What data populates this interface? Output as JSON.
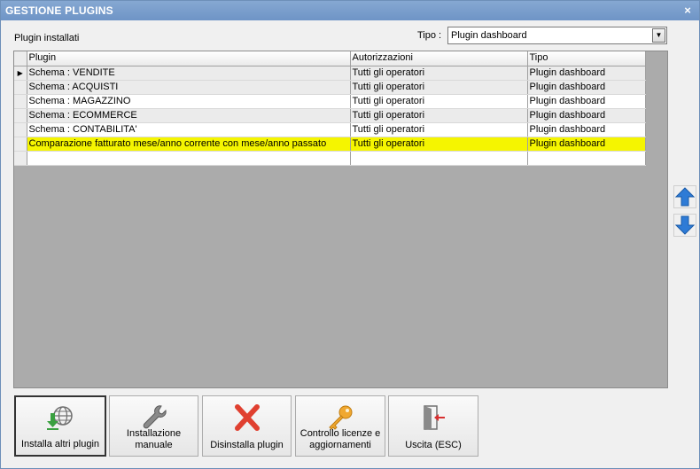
{
  "window": {
    "title": "GESTIONE PLUGINS",
    "close_glyph": "×"
  },
  "labels": {
    "installed": "Plugin installati",
    "tipo": "Tipo :"
  },
  "tipo_select": {
    "value": "Plugin dashboard",
    "arrow_glyph": "▼"
  },
  "grid": {
    "columns": [
      "Plugin",
      "Autorizzazioni",
      "Tipo"
    ],
    "current_row_glyph": "▶",
    "rows": [
      {
        "plugin": "Schema : VENDITE",
        "auth": "Tutti gli operatori",
        "tipo": "Plugin dashboard"
      },
      {
        "plugin": "Schema : ACQUISTI",
        "auth": "Tutti gli operatori",
        "tipo": "Plugin dashboard"
      },
      {
        "plugin": "Schema : MAGAZZINO",
        "auth": "Tutti gli operatori",
        "tipo": "Plugin dashboard"
      },
      {
        "plugin": "Schema : ECOMMERCE",
        "auth": "Tutti gli operatori",
        "tipo": "Plugin dashboard"
      },
      {
        "plugin": "Schema : CONTABILITA'",
        "auth": "Tutti gli operatori",
        "tipo": "Plugin dashboard"
      },
      {
        "plugin": "Comparazione fatturato mese/anno corrente con mese/anno passato",
        "auth": "Tutti gli operatori",
        "tipo": "Plugin dashboard"
      }
    ],
    "highlight_color": "#f5f500"
  },
  "buttons": {
    "install_other": "Installa altri plugin",
    "manual_line1": "Installazione",
    "manual_line2": "manuale",
    "uninstall": "Disinstalla plugin",
    "license_line1": "Controllo licenze e",
    "license_line2": "aggiornamenti",
    "exit": "Uscita (ESC)"
  },
  "icons": {
    "install": "globe-download-icon",
    "manual": "wrench-icon",
    "uninstall": "red-x-icon",
    "license": "key-icon",
    "exit": "exit-door-icon",
    "up": "arrow-up-icon",
    "down": "arrow-down-icon"
  },
  "colors": {
    "title_bar": "#7a9ccc",
    "arrow_blue": "#2e7bd6",
    "uninstall_red": "#e04030",
    "key_gold": "#f0a830"
  }
}
